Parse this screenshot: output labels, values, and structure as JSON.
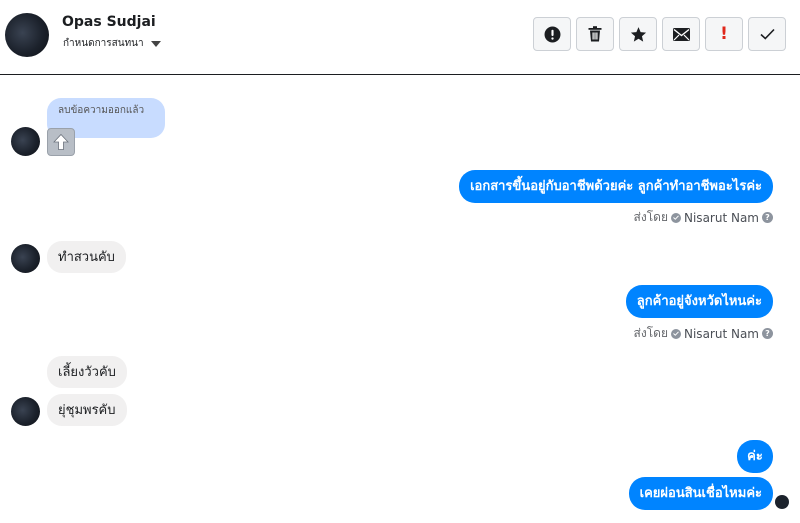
{
  "header": {
    "contact_name": "Opas Sudjai",
    "assign_label": "กำหนดการสนทนา",
    "actions": [
      {
        "icon": "exclamation-circle-icon"
      },
      {
        "icon": "trash-icon"
      },
      {
        "icon": "star-icon"
      },
      {
        "icon": "envelope-icon"
      },
      {
        "icon": "exclamation-red-icon",
        "label": "!"
      },
      {
        "icon": "check-icon"
      }
    ]
  },
  "colors": {
    "outgoing_bubble": "#0084ff",
    "incoming_bubble": "#f1f0f0",
    "deleted_bubble": "#c8dcff",
    "urgent": "#e0271b"
  },
  "messages": {
    "deleted_notice": "ลบข้อความออกแล้ว",
    "deleted_attachment_icon": "up-arrow-icon",
    "out1": "เอกสารขึ้นอยู่กับอาชีพด้วยค่ะ ลูกค้าทำอาชีพอะไรค่ะ",
    "in1": "ทำสวนคับ",
    "out2": "ลูกค้าอยู่จังหวัดไหนค่ะ",
    "in2": "เลี้ยงวัวคับ",
    "in3": "ยุ่ชุมพรคับ",
    "out3": "ค่ะ",
    "out4": "เคยผ่อนสินเชื่อไหมค่ะ"
  },
  "sent_by": {
    "prefix": "ส่งโดย",
    "agent": "Nisarut Nam"
  }
}
